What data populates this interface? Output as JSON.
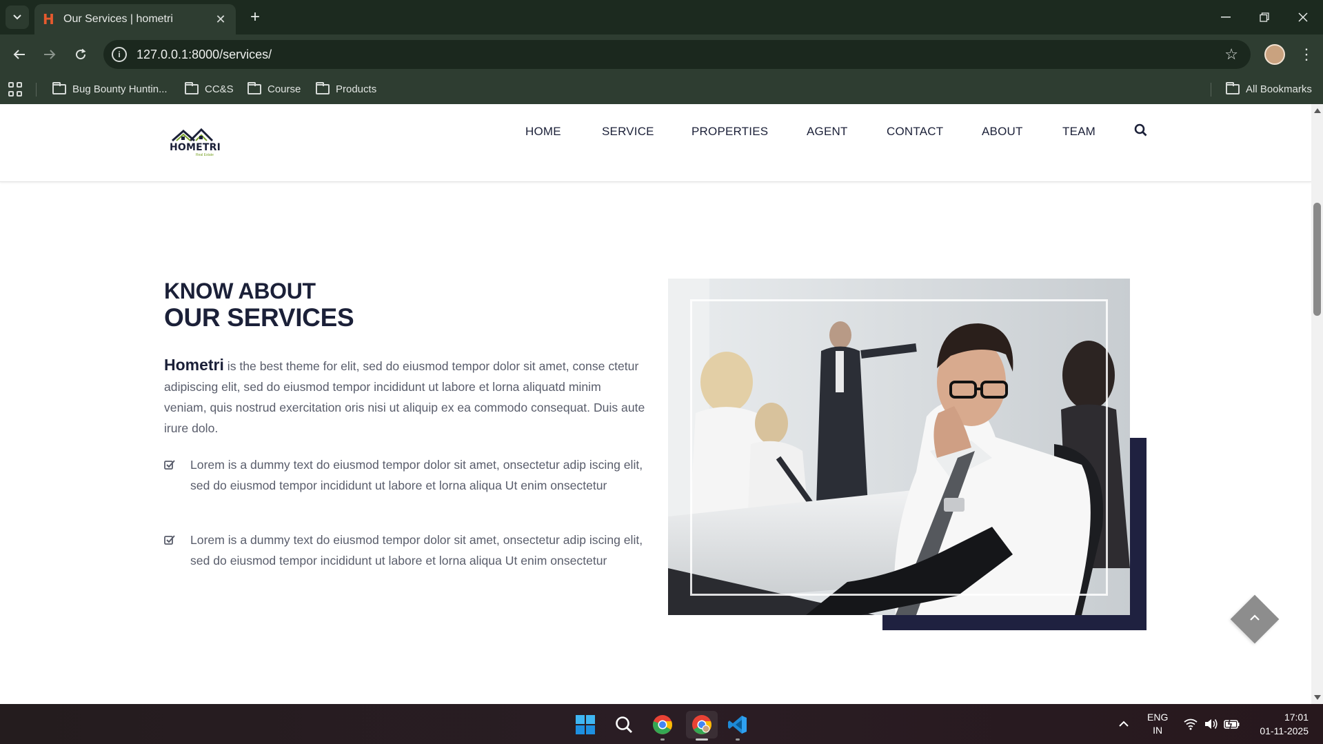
{
  "browser": {
    "tab_title": "Our Services | hometri",
    "url": "127.0.0.1:8000/services/",
    "bookmarks": [
      {
        "label": "Bug Bounty Huntin..."
      },
      {
        "label": "CC&S"
      },
      {
        "label": "Course"
      },
      {
        "label": "Products"
      }
    ],
    "all_bookmarks": "All Bookmarks"
  },
  "site": {
    "logo_text": "HOMETRI",
    "logo_sub": "Real Estate",
    "nav": [
      "HOME",
      "SERVICE",
      "PROPERTIES",
      "AGENT",
      "CONTACT",
      "ABOUT",
      "TEAM"
    ]
  },
  "section": {
    "title_line1": "KNOW ABOUT",
    "title_line2": "OUR SERVICES",
    "brand": "Hometri",
    "intro": " is the best theme for elit, sed do eiusmod tempor dolor sit amet, conse ctetur adipiscing elit, sed do eiusmod tempor incididunt ut labore et lorna aliquatd minim veniam, quis nostrud exercitation oris nisi ut aliquip ex ea commodo consequat. Duis aute irure dolo.",
    "bullets": [
      "Lorem is a dummy text do eiusmod tempor dolor sit amet, onsectetur adip iscing elit, sed do eiusmod tempor incididunt ut labore et lorna aliqua Ut enim onsectetur",
      "Lorem is a dummy text do eiusmod tempor dolor sit amet, onsectetur adip iscing elit, sed do eiusmod tempor incididunt ut labore et lorna aliqua Ut enim onsectetur"
    ]
  },
  "taskbar": {
    "lang_line1": "ENG",
    "lang_line2": "IN",
    "time": "17:01",
    "date": "01-11-2025"
  },
  "colors": {
    "chrome_dark": "#1c2a1f",
    "chrome_toolbar": "#2e3d31",
    "brand_navy": "#1b2038",
    "accent_block": "#1f2140",
    "body_text": "#595d6b"
  }
}
